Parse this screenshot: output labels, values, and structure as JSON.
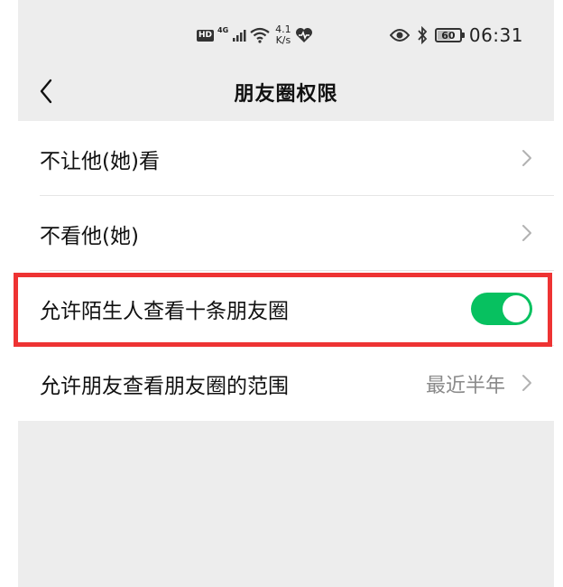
{
  "status_bar": {
    "hd": "HD",
    "network_type": "4G",
    "speed_value": "4.1",
    "speed_unit": "K/s",
    "battery_level": "60",
    "time": "06:31"
  },
  "nav": {
    "title": "朋友圈权限"
  },
  "list": {
    "items": [
      {
        "label": "不让他(她)看"
      },
      {
        "label": "不看他(她)"
      },
      {
        "label": "允许陌生人查看十条朋友圈",
        "toggle_on": true
      },
      {
        "label": "允许朋友查看朋友圈的范围",
        "value": "最近半年"
      }
    ]
  },
  "colors": {
    "toggle_on": "#07c160",
    "highlight": "#ee3333",
    "background": "#ededed"
  }
}
